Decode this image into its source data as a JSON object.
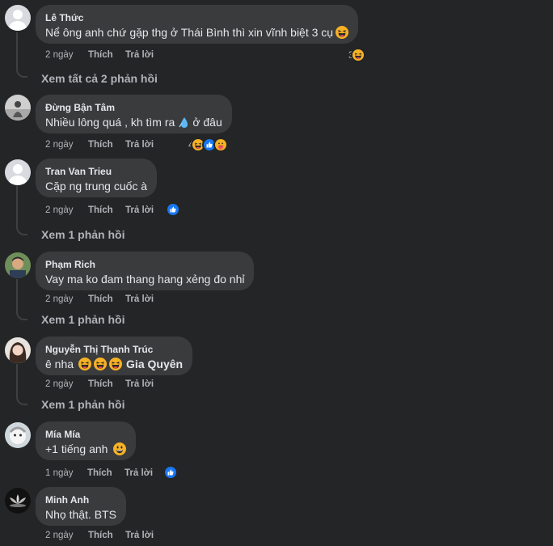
{
  "comments": [
    {
      "author": "Lê Thức",
      "text": "Nể ông anh chứ gặp thg ở Thái Bình thì xin vĩnh biệt 3 cụ",
      "time": "2 ngày",
      "like": "Thích",
      "reply": "Trả lời",
      "reaction_count": "3",
      "reactions": [
        "haha-icon"
      ],
      "view_replies": "Xem tất cả 2 phản hồi"
    },
    {
      "author": "Đừng Bận Tâm",
      "text": "Nhiều lông quá , kh tìm ra",
      "text_suffix": " ở đâu",
      "time": "2 ngày",
      "like": "Thích",
      "reply": "Trả lời",
      "reaction_count": "4",
      "reactions": [
        "haha-icon",
        "like-icon",
        "care-icon"
      ]
    },
    {
      "author": "Tran Van Trieu",
      "text": "Cặp ng trung cuốc à",
      "time": "2 ngày",
      "like": "Thích",
      "reply": "Trả lời",
      "reactions": [
        "like-icon"
      ],
      "view_replies": "Xem 1 phản hồi"
    },
    {
      "author": "Phạm Rich",
      "text": "Vay ma ko đam thang hang xẻng đo nhỉ",
      "time": "2 ngày",
      "like": "Thích",
      "reply": "Trả lời",
      "view_replies": "Xem 1 phản hồi"
    },
    {
      "author": "Nguyễn Thị Thanh Trúc",
      "text": "ê nha",
      "mention": "Gia Quyên",
      "time": "2 ngày",
      "like": "Thích",
      "reply": "Trả lời",
      "view_replies": "Xem 1 phản hồi"
    },
    {
      "author": "Mía Mía",
      "text": "+1 tiếng anh",
      "time": "1 ngày",
      "like": "Thích",
      "reply": "Trả lời",
      "reactions": [
        "like-icon"
      ]
    },
    {
      "author": "Minh Anh",
      "text": "Nhọ thật. BTS",
      "time": "2 ngày",
      "like": "Thích",
      "reply": "Trả lời"
    }
  ],
  "colors": {
    "background": "#242526",
    "bubble": "#3a3b3c",
    "text": "#e4e6eb",
    "secondary": "#b0b3b8",
    "like_blue": "#1877f2",
    "haha_yellow": "#f7b125"
  }
}
